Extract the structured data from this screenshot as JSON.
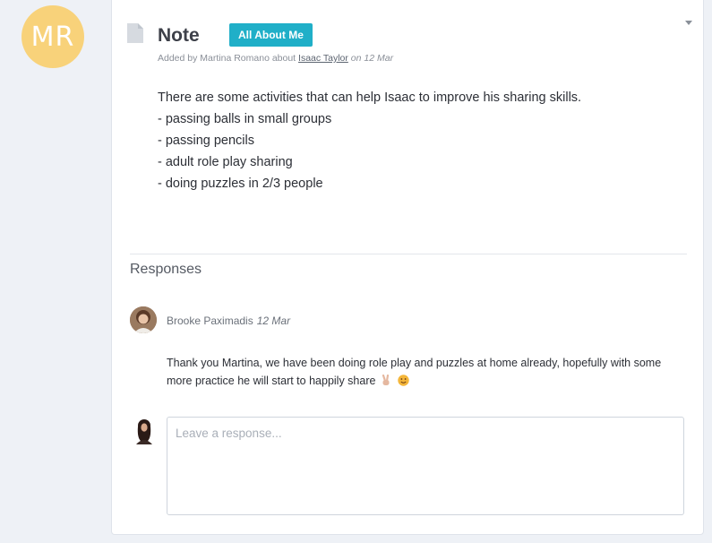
{
  "author_avatar": {
    "initials": "MR",
    "color": "#f8d27a"
  },
  "note": {
    "icon": "document-icon",
    "title": "Note",
    "tag": "All About Me",
    "tag_color": "#20afc8",
    "meta_prefix": "Added by Martina Romano about",
    "child_name": "Isaac Taylor",
    "meta_date": "on 12 Mar",
    "body_lines": [
      "There are some activities that can help Isaac to improve his sharing skills.",
      "- passing balls in small groups",
      "- passing pencils",
      "- adult role play sharing",
      "- doing puzzles in 2/3 people"
    ]
  },
  "responses": {
    "heading": "Responses",
    "items": [
      {
        "author": "Brooke Paximadis",
        "date": "12 Mar",
        "body": "Thank you Martina, we have been doing role play and puzzles at home already, hopefully with some more practice he will start to happily share"
      }
    ],
    "input_placeholder": "Leave a response..."
  }
}
